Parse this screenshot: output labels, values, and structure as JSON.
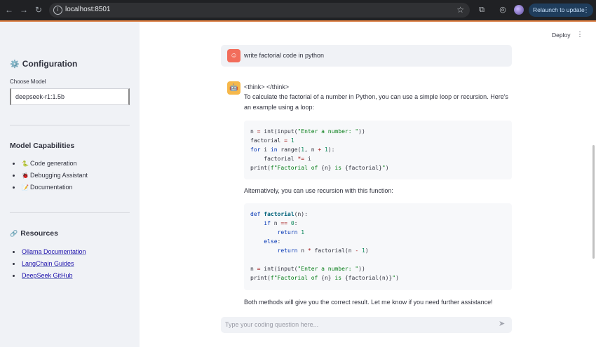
{
  "browser": {
    "url": "localhost:8501",
    "relaunch_label": "Relaunch to update"
  },
  "sidebar": {
    "config_title": "Configuration",
    "model_label": "Choose Model",
    "model_value": "deepseek-r1:1.5b",
    "capabilities_title": "Model Capabilities",
    "capabilities": [
      {
        "emoji": "🐍",
        "label": "Code generation"
      },
      {
        "emoji": "🐞",
        "label": "Debugging Assistant"
      },
      {
        "emoji": "📝",
        "label": "Documentation"
      }
    ],
    "resources_title": "Resources",
    "resources": [
      "Ollama Documentation",
      "LangChain Guides",
      "DeepSeek GitHub"
    ]
  },
  "header": {
    "deploy_label": "Deploy"
  },
  "chat": {
    "user_message": "write factorial code in python",
    "think": "<think> </think>",
    "intro": "To calculate the factorial of a number in Python, you can use a simple loop or recursion. Here's an example using a loop:",
    "middle": "Alternatively, you can use recursion with this function:",
    "outro": "Both methods will give you the correct result. Let me know if you need further assistance!",
    "input_placeholder": "Type your coding question here..."
  },
  "colors": {
    "sidebar_bg": "#f0f2f6",
    "accent_line": "#d97b3f",
    "assistant_avatar": "#f6b84b",
    "user_avatar": "#f26d5b"
  }
}
